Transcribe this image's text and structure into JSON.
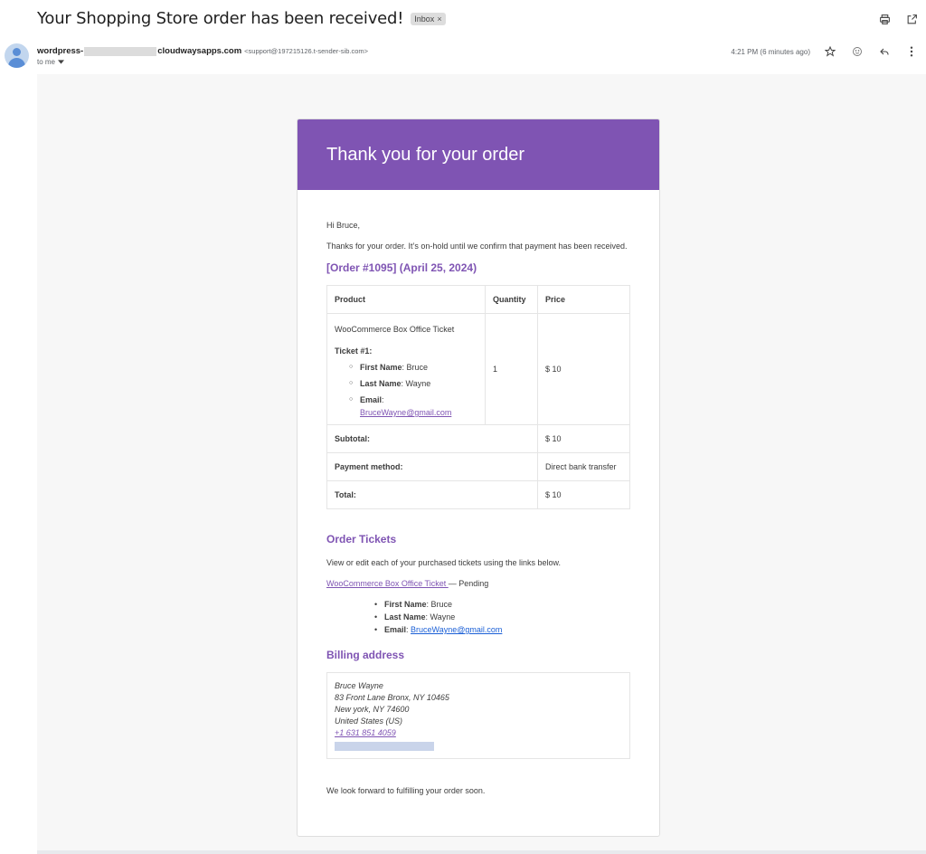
{
  "email": {
    "subject": "Your Shopping Store order has been received!",
    "label": "Inbox",
    "label_close": "×",
    "sender": {
      "name_prefix": "wordpress-",
      "name_suffix": "cloudwaysapps.com",
      "email": "<support@197215126.t-sender-sib.com>"
    },
    "to": "to me",
    "time": "4:21 PM (6 minutes ago)"
  },
  "icons": {
    "print": "print-icon",
    "new_window": "open-in-new-window-icon",
    "star": "star-icon",
    "emoji": "emoji-icon",
    "reply": "reply-icon",
    "more": "more-vert-icon"
  },
  "colors": {
    "accent": "#7f54b3",
    "link_blue": "#1a5fd6"
  },
  "message": {
    "hero_title": "Thank you for your order",
    "greeting": "Hi Bruce,",
    "intro": "Thanks for your order. It’s on-hold until we confirm that payment has been received.",
    "order_heading": "[Order #1095] (April 25, 2024)",
    "table": {
      "headers": {
        "product": "Product",
        "quantity": "Quantity",
        "price": "Price"
      },
      "item": {
        "name": "WooCommerce Box Office Ticket",
        "ticket_label": "Ticket #1:",
        "fields": [
          {
            "label": "First Name",
            "value": "Bruce"
          },
          {
            "label": "Last Name",
            "value": "Wayne"
          },
          {
            "label": "Email",
            "value": "BruceWayne@gmail.com"
          }
        ],
        "quantity": "1",
        "price": "$ 10"
      },
      "totals": [
        {
          "label": "Subtotal:",
          "value": "$ 10"
        },
        {
          "label": "Payment method:",
          "value": "Direct bank transfer"
        },
        {
          "label": "Total:",
          "value": "$ 10"
        }
      ]
    },
    "tickets_heading": "Order Tickets",
    "tickets_intro": "View or edit each of your purchased tickets using the links below.",
    "ticket_link": "WooCommerce Box Office Ticket ",
    "ticket_status": "— Pending",
    "ticket_fields": [
      {
        "label": "First Name",
        "value": "Bruce"
      },
      {
        "label": "Last Name",
        "value": "Wayne"
      },
      {
        "label": "Email",
        "value": "BruceWayne@gmail.com"
      }
    ],
    "billing_heading": "Billing address",
    "billing": {
      "name": "Bruce Wayne",
      "line1": "83 Front Lane Bronx, NY 10465",
      "line2": "New york, NY 74600",
      "country": "United States (US)",
      "phone": "+1 631 851 4059"
    },
    "closing": "We look forward to fulfilling your order soon."
  }
}
